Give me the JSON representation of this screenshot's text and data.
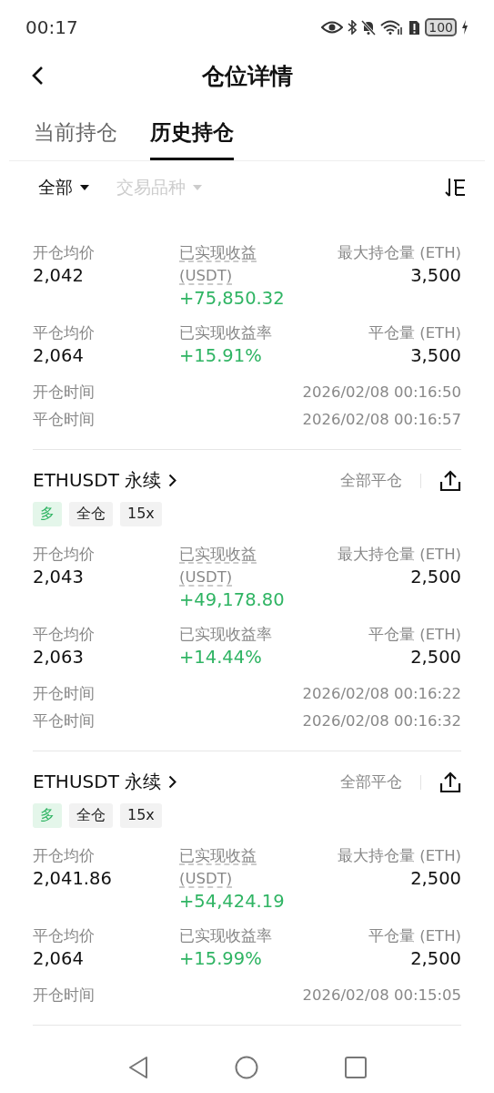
{
  "status_bar": {
    "time": "00:17",
    "battery": "100"
  },
  "header": {
    "title": "仓位详情"
  },
  "tabs": [
    {
      "label": "当前持仓",
      "selected": false
    },
    {
      "label": "历史持仓",
      "selected": true
    }
  ],
  "filters": [
    {
      "label": "全部",
      "disabled": false
    },
    {
      "label": "交易品种",
      "disabled": true
    }
  ],
  "positions": [
    {
      "stats": [
        {
          "label": "开仓均价",
          "value": "2,042",
          "kind": "plain"
        },
        {
          "label": "已实现收益 (USDT)",
          "value": "+75,850.32",
          "kind": "pnl"
        },
        {
          "label": "最大持仓量 (ETH)",
          "value": "3,500",
          "kind": "plain"
        },
        {
          "label": "平仓均价",
          "value": "2,064",
          "kind": "plain"
        },
        {
          "label": "已实现收益率",
          "value": "+15.91%",
          "kind": "pnl"
        },
        {
          "label": "平仓量 (ETH)",
          "value": "3,500",
          "kind": "plain"
        }
      ],
      "times": [
        {
          "label": "开仓时间",
          "value": "2026/02/08 00:16:50"
        },
        {
          "label": "平仓时间",
          "value": "2026/02/08 00:16:57"
        }
      ]
    },
    {
      "symbol": "ETHUSDT 永续",
      "action": "全部平仓",
      "tags": [
        {
          "label": "多",
          "kind": "side"
        },
        {
          "label": "全仓",
          "kind": "plain"
        },
        {
          "label": "15x",
          "kind": "plain"
        }
      ],
      "stats": [
        {
          "label": "开仓均价",
          "value": "2,043",
          "kind": "plain"
        },
        {
          "label": "已实现收益 (USDT)",
          "value": "+49,178.80",
          "kind": "pnl"
        },
        {
          "label": "最大持仓量 (ETH)",
          "value": "2,500",
          "kind": "plain"
        },
        {
          "label": "平仓均价",
          "value": "2,063",
          "kind": "plain"
        },
        {
          "label": "已实现收益率",
          "value": "+14.44%",
          "kind": "pnl"
        },
        {
          "label": "平仓量 (ETH)",
          "value": "2,500",
          "kind": "plain"
        }
      ],
      "times": [
        {
          "label": "开仓时间",
          "value": "2026/02/08 00:16:22"
        },
        {
          "label": "平仓时间",
          "value": "2026/02/08 00:16:32"
        }
      ]
    },
    {
      "symbol": "ETHUSDT 永续",
      "action": "全部平仓",
      "tags": [
        {
          "label": "多",
          "kind": "side"
        },
        {
          "label": "全仓",
          "kind": "plain"
        },
        {
          "label": "15x",
          "kind": "plain"
        }
      ],
      "stats": [
        {
          "label": "开仓均价",
          "value": "2,041.86",
          "kind": "plain"
        },
        {
          "label": "已实现收益 (USDT)",
          "value": "+54,424.19",
          "kind": "pnl"
        },
        {
          "label": "最大持仓量 (ETH)",
          "value": "2,500",
          "kind": "plain"
        },
        {
          "label": "平仓均价",
          "value": "2,064",
          "kind": "plain"
        },
        {
          "label": "已实现收益率",
          "value": "+15.99%",
          "kind": "pnl"
        },
        {
          "label": "平仓量 (ETH)",
          "value": "2,500",
          "kind": "plain"
        }
      ],
      "times": [
        {
          "label": "开仓时间",
          "value": "2026/02/08 00:15:05"
        }
      ]
    }
  ]
}
